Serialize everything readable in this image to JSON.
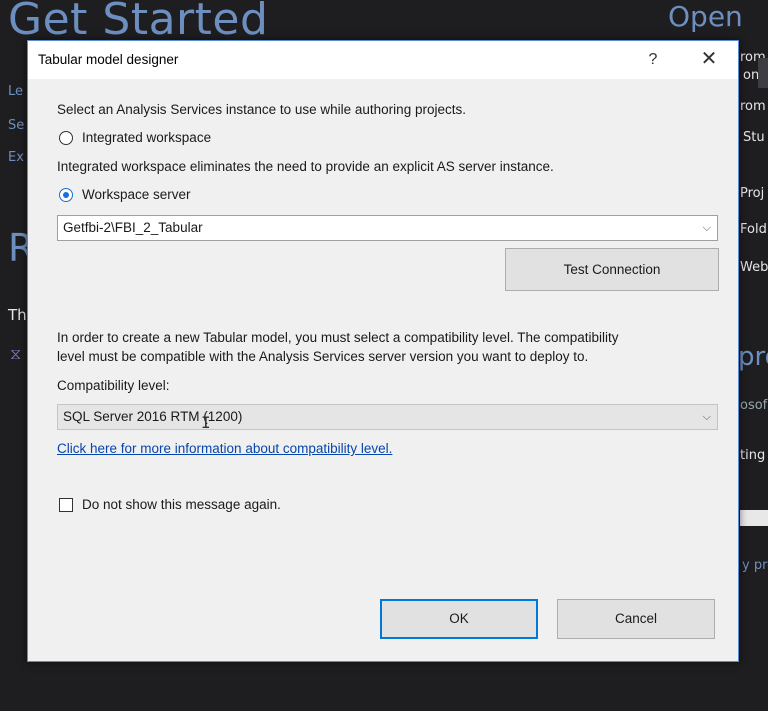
{
  "background": {
    "title": "Get Started",
    "open": "Open",
    "left_items": [
      "Le",
      "Se",
      "Ex"
    ],
    "heading_r": "R",
    "th": "Th",
    "right_items": [
      "rom a",
      "on y",
      "rom",
      "Stu",
      "Proj",
      "Fold",
      "Web"
    ],
    "pro": "pro",
    "right_lower": [
      "osof",
      "ting"
    ],
    "link_pro": "y pro"
  },
  "dialog": {
    "title": "Tabular model designer",
    "help_label": "?",
    "close_label": "✕",
    "intro": "Select an Analysis Services instance to use while authoring projects.",
    "integrated_label": "Integrated workspace",
    "integrated_desc": "Integrated workspace eliminates the need to provide an explicit AS server instance.",
    "workspace_label": "Workspace server",
    "server_value": "Getfbi-2\\FBI_2_Tabular",
    "test_connection": "Test Connection",
    "compat_line1": "In order to create a new Tabular model, you must select a compatibility level. The compatibility",
    "compat_line2": "level must be compatible with the Analysis Services server version you want to deploy to.",
    "compat_label": "Compatibility level:",
    "compat_value": "SQL Server 2016 RTM (1200)",
    "compat_link": "Click here for more information about compatibility level.",
    "dont_show": "Do not show this message again.",
    "ok": "OK",
    "cancel": "Cancel"
  },
  "state": {
    "selected_mode": "Workspace server",
    "dont_show_checked": false
  },
  "icons": {
    "dropdown": "chevron-down-icon",
    "close": "close-icon",
    "help": "help-icon"
  },
  "colors": {
    "accent": "#0078d7",
    "link": "#0645ad",
    "background": "#1e1e20"
  }
}
